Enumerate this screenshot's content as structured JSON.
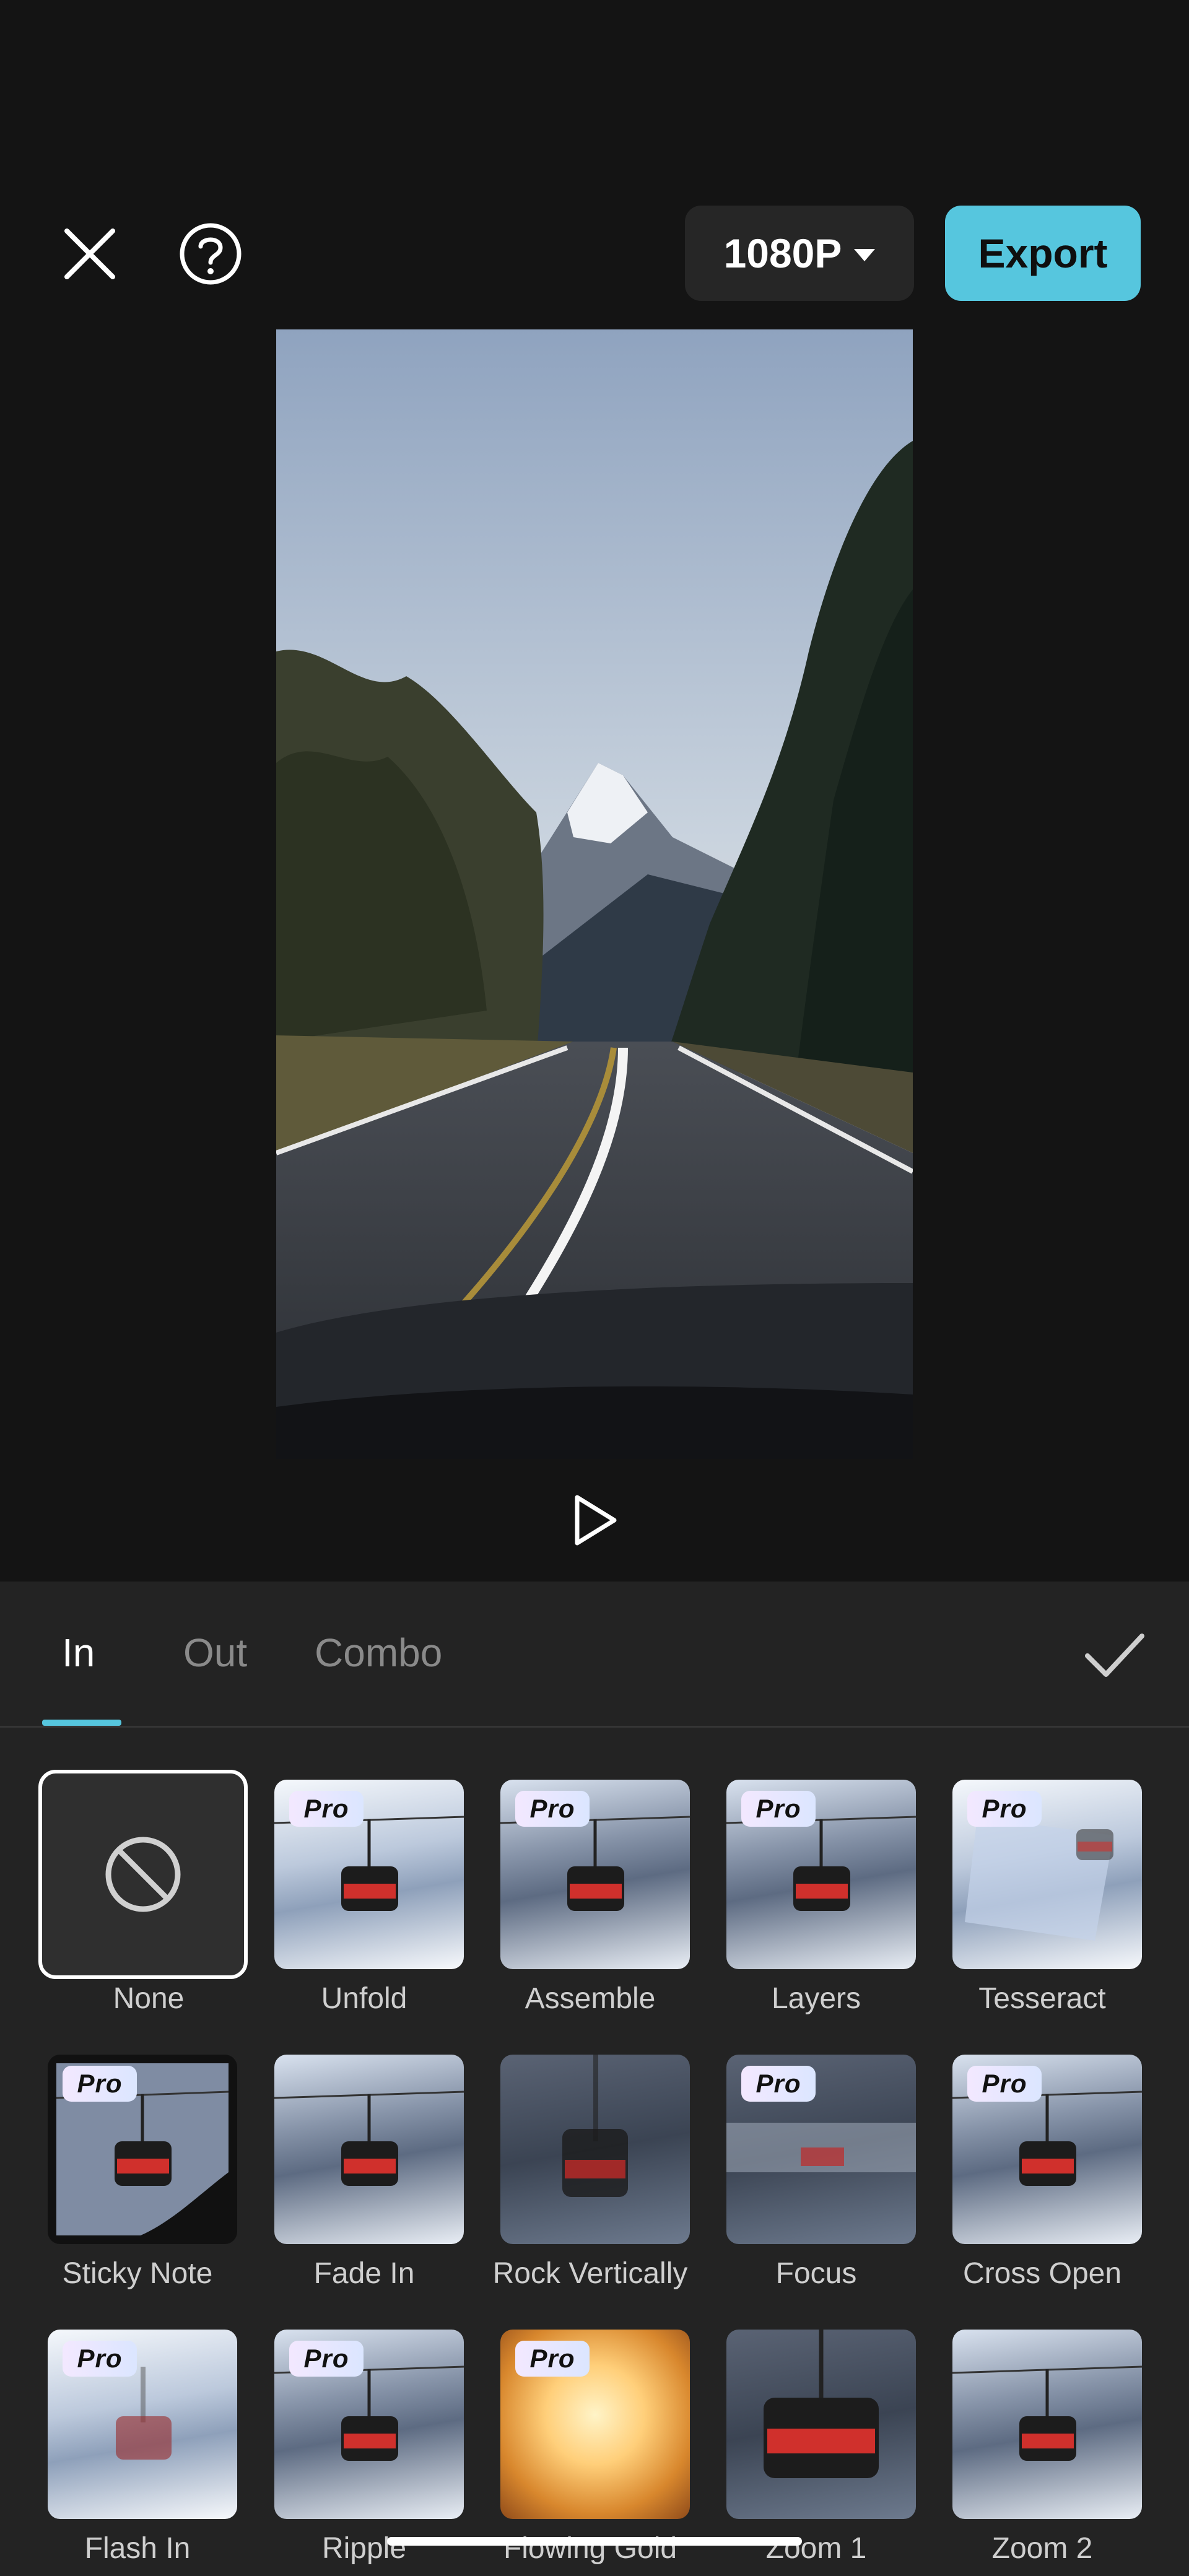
{
  "toolbar": {
    "resolution_label": "1080P",
    "export_label": "Export"
  },
  "tabs": [
    {
      "label": "In",
      "active": true
    },
    {
      "label": "Out",
      "active": false
    },
    {
      "label": "Combo",
      "active": false
    }
  ],
  "pro_label": "Pro",
  "effects": [
    {
      "label": "None",
      "pro": false,
      "selected": true
    },
    {
      "label": "Unfold",
      "pro": true
    },
    {
      "label": "Assemble",
      "pro": true
    },
    {
      "label": "Layers",
      "pro": true
    },
    {
      "label": "Tesseract",
      "pro": true
    },
    {
      "label": "Sticky Note",
      "pro": true
    },
    {
      "label": "Fade In",
      "pro": false
    },
    {
      "label": "Rock Vertically",
      "pro": false
    },
    {
      "label": "Focus",
      "pro": true
    },
    {
      "label": "Cross Open",
      "pro": true
    },
    {
      "label": "Flash In",
      "pro": true
    },
    {
      "label": "Ripple",
      "pro": true
    },
    {
      "label": "Flowing Gold",
      "pro": true
    },
    {
      "label": "Zoom 1",
      "pro": false
    },
    {
      "label": "Zoom 2",
      "pro": false
    }
  ],
  "colors": {
    "accent": "#56c6de",
    "background": "#141414",
    "panel": "#232323"
  }
}
